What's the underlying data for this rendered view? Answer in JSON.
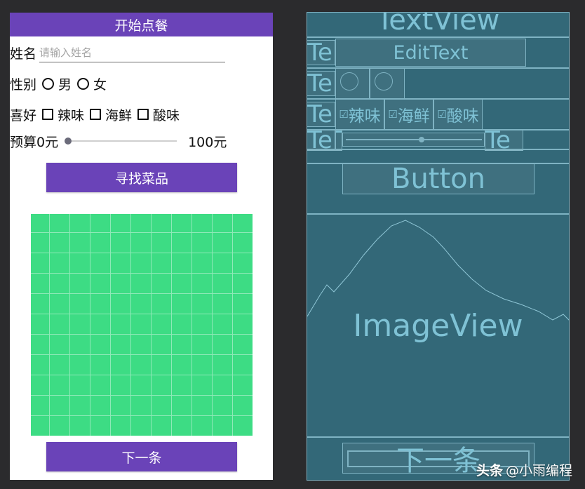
{
  "app": {
    "title": "开始点餐"
  },
  "form": {
    "name_label": "姓名",
    "name_placeholder": "请输入姓名",
    "gender_label": "性别",
    "gender_options": [
      "男",
      "女"
    ],
    "hobby_label": "喜好",
    "hobby_options": [
      "辣味",
      "海鲜",
      "酸味"
    ],
    "budget_label": "预算0元",
    "budget_max": "100元",
    "budget_value": 0
  },
  "buttons": {
    "find": "寻找菜品",
    "next": "下一条"
  },
  "blueprint": {
    "textview": "TextView",
    "edittext": "EditText",
    "te": "Te",
    "hobbies": [
      "辣味",
      "海鲜",
      "酸味"
    ],
    "button": "Button",
    "imageview": "ImageView",
    "next": "下一条"
  },
  "watermark": {
    "brand": "头条",
    "handle": "@小雨编程"
  },
  "colors": {
    "primary": "#6a43b8",
    "image_green": "#3ddc84",
    "blueprint_bg": "#275f70"
  }
}
